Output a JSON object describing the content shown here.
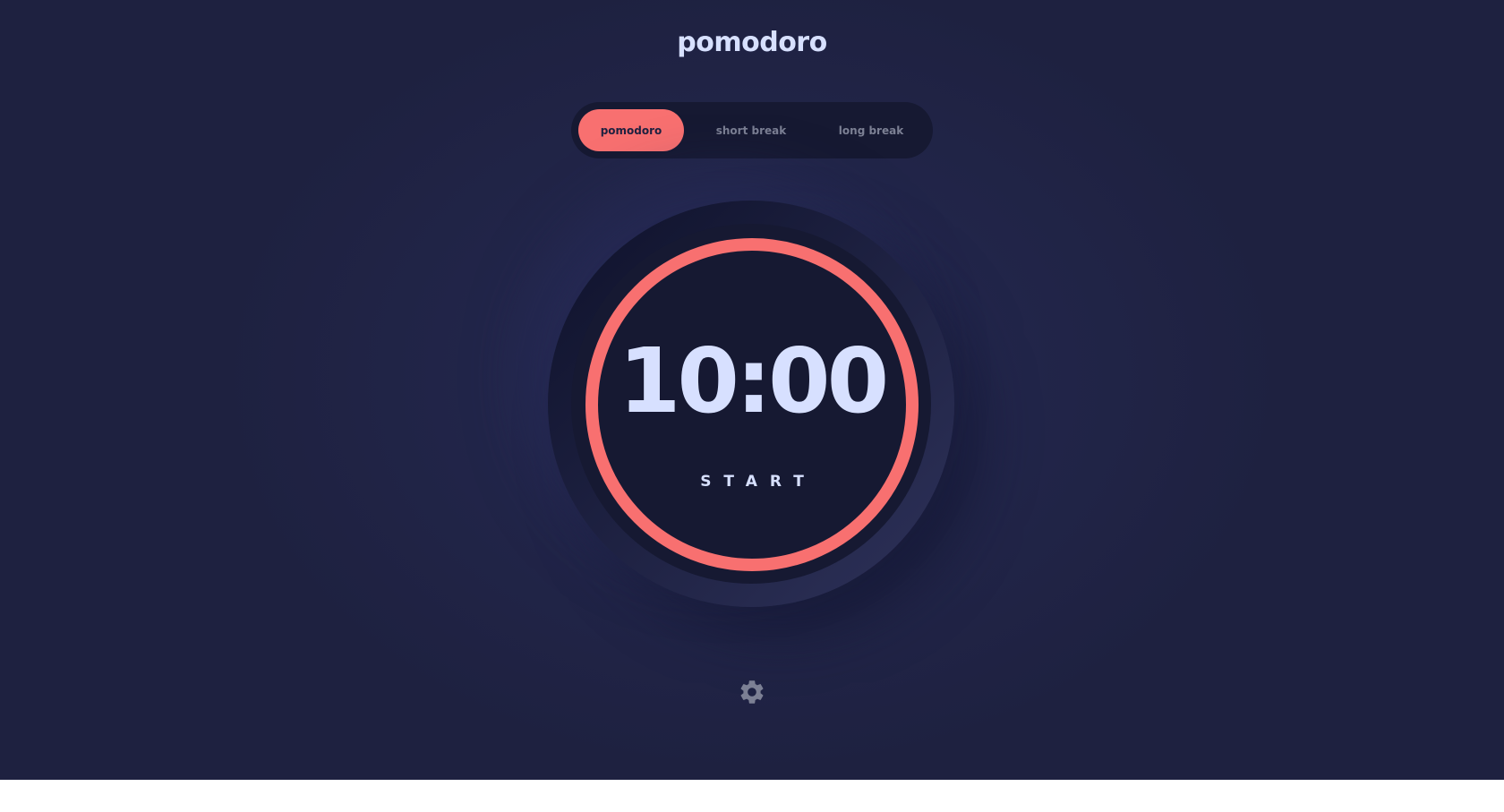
{
  "app": {
    "title": "pomodoro"
  },
  "modes": {
    "tabs": [
      {
        "label": "pomodoro",
        "active": true
      },
      {
        "label": "short break",
        "active": false
      },
      {
        "label": "long break",
        "active": false
      }
    ]
  },
  "timer": {
    "time": "10:00",
    "action_label": "START",
    "progress": 1.0,
    "accent_color": "#f87070"
  },
  "settings": {
    "icon": "gear-icon"
  },
  "colors": {
    "background": "#1e2140",
    "panel": "#161932",
    "text": "#d7e0ff",
    "muted": "#7c8094",
    "accent": "#f87070"
  }
}
